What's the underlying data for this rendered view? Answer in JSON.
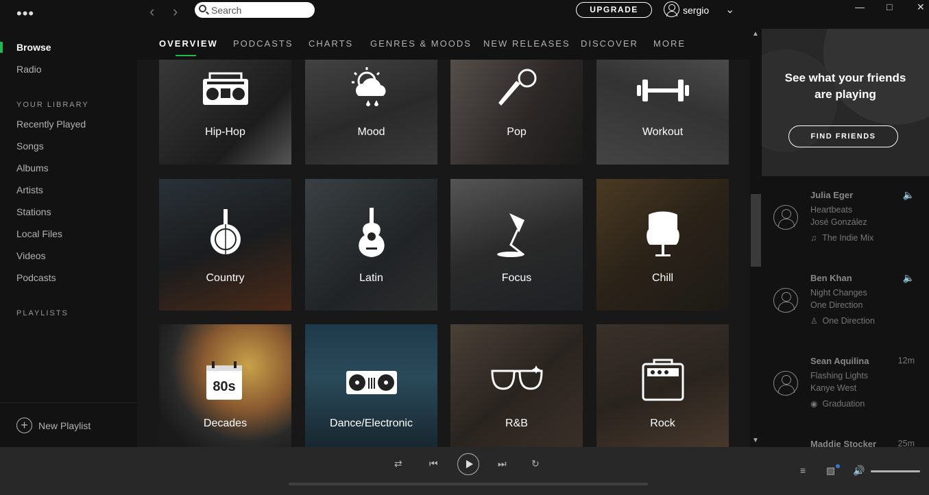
{
  "sidebar": {
    "menu_label": "•••",
    "nav": [
      "Browse",
      "Radio"
    ],
    "library_title": "YOUR LIBRARY",
    "library": [
      "Recently Played",
      "Songs",
      "Albums",
      "Artists",
      "Stations",
      "Local Files",
      "Videos",
      "Podcasts"
    ],
    "playlists_title": "PLAYLISTS",
    "new_playlist": "New Playlist"
  },
  "topbar": {
    "search_placeholder": "Search",
    "upgrade": "UPGRADE",
    "user": "sergio"
  },
  "tabs": [
    "OVERVIEW",
    "PODCASTS",
    "CHARTS",
    "GENRES & MOODS",
    "NEW RELEASES",
    "DISCOVER",
    "MORE"
  ],
  "tiles": [
    {
      "label": "Hip-Hop",
      "icon": "boombox-icon"
    },
    {
      "label": "Mood",
      "icon": "weather-icon"
    },
    {
      "label": "Pop",
      "icon": "microphone-icon"
    },
    {
      "label": "Workout",
      "icon": "dumbbell-icon"
    },
    {
      "label": "Country",
      "icon": "banjo-icon"
    },
    {
      "label": "Latin",
      "icon": "guitar-icon"
    },
    {
      "label": "Focus",
      "icon": "lamp-icon"
    },
    {
      "label": "Chill",
      "icon": "egg-chair-icon"
    },
    {
      "label": "Decades",
      "icon": "calendar-80s-icon",
      "badge": "80s"
    },
    {
      "label": "Dance/Electronic",
      "icon": "turntables-icon"
    },
    {
      "label": "R&B",
      "icon": "sunglasses-icon"
    },
    {
      "label": "Rock",
      "icon": "amplifier-icon"
    }
  ],
  "friends": {
    "headline_1": "See what your friends",
    "headline_2": "are playing",
    "find_button": "FIND FRIENDS",
    "list": [
      {
        "name": "Julia Eger",
        "track": "Heartbeats",
        "artist": "José González",
        "context": "The Indie Mix",
        "time": ""
      },
      {
        "name": "Ben Khan",
        "track": "Night Changes",
        "artist": "One Direction",
        "context": "One Direction",
        "time": ""
      },
      {
        "name": "Sean Aquilina",
        "track": "Flashing Lights",
        "artist": "Kanye West",
        "context": "Graduation",
        "time": "12m"
      },
      {
        "name": "Maddie Stocker",
        "track": "",
        "artist": "",
        "context": "",
        "time": "25m"
      }
    ]
  },
  "colors": {
    "accent": "#1db954",
    "background": "#121212",
    "player": "#282828"
  }
}
